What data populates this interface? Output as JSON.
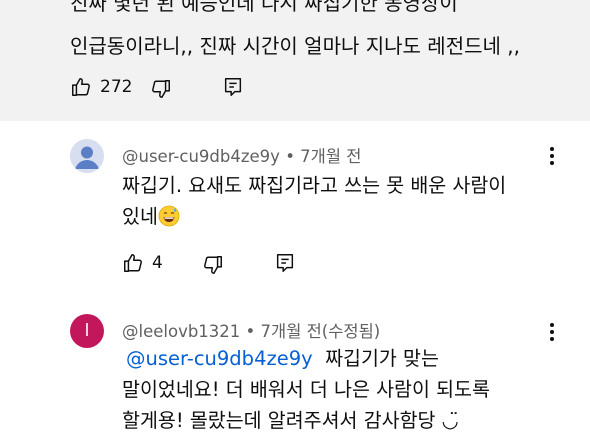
{
  "parent_comment": {
    "line1": "진짜 몇년 된 예능인데 다시 짜집기한 동영상이",
    "line2": "인급동이라니,, 진짜 시간이 얼마나 지나도 레전드네 ,,",
    "likes": "272"
  },
  "replies": [
    {
      "author": "@user-cu9db4ze9y",
      "time": "• 7개월 전",
      "line1": "짜깁기. 요새도 짜집기라고 쓰는 못 배운 사람이",
      "line2": "있네",
      "emoji": "grinning-sweat-emoji",
      "likes": "4"
    },
    {
      "author": "@leelovb1321",
      "avatar_letter": "l",
      "time": "• 7개월 전(수정됨)",
      "mention": "@user-cu9db4ze9y",
      "line1_rest": "짜깁기가 맞는",
      "line2": "말이었네요! 더 배워서 더 나은 사람이 되도록",
      "line3": "할게용!  몰랐는데 알려주셔서 감사함당 ◡̈"
    }
  ],
  "colors": {
    "highlight_bg": "#f2f2f2",
    "mention": "#065fd4",
    "meta": "#606060",
    "avatar_letter_bg": "#c2185b"
  }
}
